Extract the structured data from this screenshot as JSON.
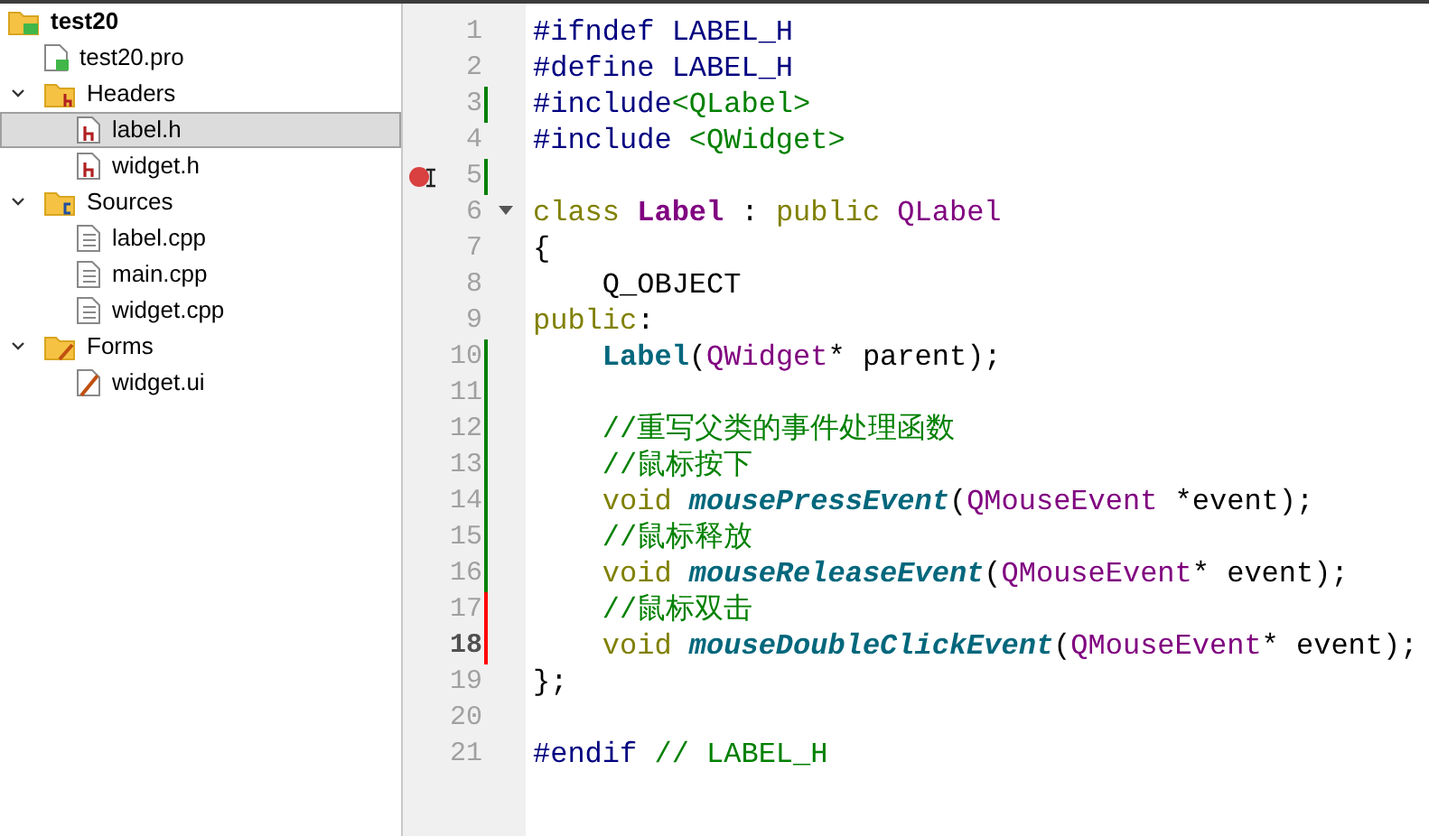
{
  "project_tree": [
    {
      "label": "test20",
      "kind": "project",
      "selected": false,
      "children": [
        {
          "label": "test20.pro",
          "kind": "pro",
          "selected": false
        },
        {
          "label": "Headers",
          "kind": "headers",
          "expanded": true,
          "selected": false,
          "children": [
            {
              "label": "label.h",
              "kind": "header",
              "selected": true
            },
            {
              "label": "widget.h",
              "kind": "header",
              "selected": false
            }
          ]
        },
        {
          "label": "Sources",
          "kind": "sources",
          "expanded": true,
          "selected": false,
          "children": [
            {
              "label": "label.cpp",
              "kind": "source",
              "selected": false
            },
            {
              "label": "main.cpp",
              "kind": "source",
              "selected": false
            },
            {
              "label": "widget.cpp",
              "kind": "source",
              "selected": false
            }
          ]
        },
        {
          "label": "Forms",
          "kind": "forms",
          "expanded": true,
          "selected": false,
          "children": [
            {
              "label": "widget.ui",
              "kind": "form",
              "selected": false
            }
          ]
        }
      ]
    }
  ],
  "editor": {
    "lines": [
      {
        "number": "1",
        "breakpoint": false,
        "foldable": false,
        "current": false,
        "tokens": [
          {
            "t": "#ifndef LABEL_H",
            "kind": "pre"
          }
        ]
      },
      {
        "number": "2",
        "breakpoint": false,
        "foldable": false,
        "current": false,
        "tokens": [
          {
            "t": "#define LABEL_H",
            "kind": "pre"
          }
        ]
      },
      {
        "number": "3",
        "color": "#008000",
        "breakpoint": false,
        "foldable": false,
        "current": false,
        "tokens": [
          {
            "t": "#include",
            "kind": "pre"
          },
          {
            "t": "<QLabel>",
            "kind": "str"
          }
        ]
      },
      {
        "number": "4",
        "breakpoint": false,
        "foldable": false,
        "current": false,
        "tokens": [
          {
            "t": "#include ",
            "kind": "pre"
          },
          {
            "t": "<QWidget>",
            "kind": "str"
          }
        ]
      },
      {
        "number": "5",
        "color": "#008000",
        "breakpoint": true,
        "foldable": false,
        "current": false
      },
      {
        "number": "6",
        "breakpoint": false,
        "foldable": true,
        "current": false,
        "tokens": [
          {
            "t": "class ",
            "kind": "kw"
          },
          {
            "t": "Label",
            "kind": "cls"
          },
          {
            "t": " : ",
            "kind": "plain"
          },
          {
            "t": "public ",
            "kind": "kw"
          },
          {
            "t": "QLabel",
            "kind": "type"
          }
        ]
      },
      {
        "number": "7",
        "breakpoint": false,
        "foldable": false,
        "current": false,
        "tokens": [
          {
            "t": "{",
            "kind": "plain"
          }
        ]
      },
      {
        "number": "8",
        "breakpoint": false,
        "foldable": false,
        "current": false,
        "tokens": [
          {
            "t": "    Q_OBJECT",
            "kind": "plain"
          }
        ]
      },
      {
        "number": "9",
        "breakpoint": false,
        "foldable": false,
        "current": false,
        "tokens": [
          {
            "t": "public",
            "kind": "kw"
          },
          {
            "t": ":",
            "kind": "plain"
          }
        ]
      },
      {
        "number": "10",
        "color": "#008000",
        "breakpoint": false,
        "foldable": false,
        "current": false,
        "tokens": [
          {
            "t": "    Label",
            "kind": "ctor"
          },
          {
            "t": "(",
            "kind": "plain"
          },
          {
            "t": "QWidget",
            "kind": "type"
          },
          {
            "t": "* parent);",
            "kind": "plain"
          }
        ]
      },
      {
        "number": "11",
        "color": "#008000",
        "breakpoint": false,
        "foldable": false,
        "current": false
      },
      {
        "number": "12",
        "color": "#008000",
        "breakpoint": false,
        "foldable": false,
        "current": false,
        "tokens": [
          {
            "t": "    //重写父类的事件处理函数",
            "kind": "comment"
          }
        ]
      },
      {
        "number": "13",
        "color": "#008000",
        "breakpoint": false,
        "foldable": false,
        "current": false,
        "tokens": [
          {
            "t": "    //鼠标按下",
            "kind": "comment"
          }
        ]
      },
      {
        "number": "14",
        "color": "#008000",
        "breakpoint": false,
        "foldable": false,
        "current": false,
        "tokens": [
          {
            "t": "    void ",
            "kind": "kw"
          },
          {
            "t": "mousePressEvent",
            "kind": "func"
          },
          {
            "t": "(",
            "kind": "plain"
          },
          {
            "t": "QMouseEvent",
            "kind": "type"
          },
          {
            "t": " *event);",
            "kind": "plain"
          }
        ]
      },
      {
        "number": "15",
        "color": "#008000",
        "breakpoint": false,
        "foldable": false,
        "current": false,
        "tokens": [
          {
            "t": "    //鼠标释放",
            "kind": "comment"
          }
        ]
      },
      {
        "number": "16",
        "color": "#008000",
        "breakpoint": false,
        "foldable": false,
        "current": false,
        "tokens": [
          {
            "t": "    void ",
            "kind": "kw"
          },
          {
            "t": "mouseReleaseEvent",
            "kind": "func"
          },
          {
            "t": "(",
            "kind": "plain"
          },
          {
            "t": "QMouseEvent",
            "kind": "type"
          },
          {
            "t": "* event);",
            "kind": "plain"
          }
        ]
      },
      {
        "number": "17",
        "color": "#ff0000",
        "breakpoint": false,
        "foldable": false,
        "current": false,
        "tokens": [
          {
            "t": "    //鼠标双击",
            "kind": "comment"
          }
        ]
      },
      {
        "number": "18",
        "color": "#ff0000",
        "breakpoint": false,
        "foldable": false,
        "current": true,
        "tokens": [
          {
            "t": "    void ",
            "kind": "kw"
          },
          {
            "t": "mouseDoubleClickEvent",
            "kind": "func"
          },
          {
            "t": "(",
            "kind": "plain"
          },
          {
            "t": "QMouseEvent",
            "kind": "type"
          },
          {
            "t": "* event);",
            "kind": "plain"
          }
        ]
      },
      {
        "number": "19",
        "breakpoint": false,
        "foldable": false,
        "current": false,
        "tokens": [
          {
            "t": "};",
            "kind": "plain"
          }
        ]
      },
      {
        "number": "20",
        "breakpoint": false,
        "foldable": false,
        "current": false
      },
      {
        "number": "21",
        "breakpoint": false,
        "foldable": false,
        "current": false,
        "tokens": [
          {
            "t": "#endif ",
            "kind": "pre"
          },
          {
            "t": "// LABEL_H",
            "kind": "comment"
          }
        ]
      }
    ]
  }
}
